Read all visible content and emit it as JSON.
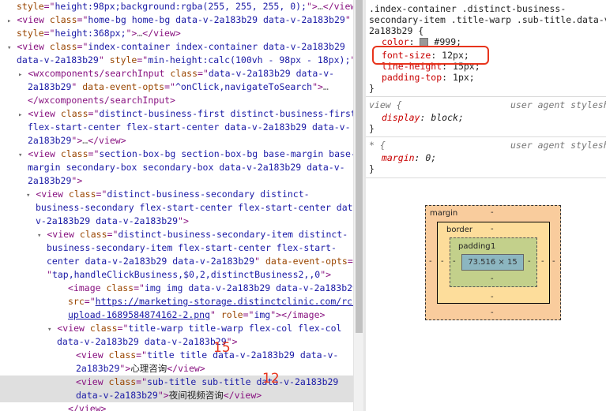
{
  "dom_lines": [
    {
      "segments": [
        {
          "c": "an",
          "t": "style"
        },
        {
          "c": "tag",
          "t": "=\""
        },
        {
          "c": "av",
          "t": "height:98px;background:rgba(255, 255, 255, 0);"
        },
        {
          "c": "tag",
          "t": "\">"
        },
        {
          "c": "gy",
          "t": "…"
        },
        {
          "c": "tag",
          "t": "</view>"
        }
      ]
    },
    {
      "segments": [
        {
          "c": "ar",
          "t": "▸"
        },
        {
          "c": "tag",
          "t": "<view "
        },
        {
          "c": "an",
          "t": "class"
        },
        {
          "c": "tag",
          "t": "=\""
        },
        {
          "c": "av",
          "t": "home-bg home-bg data-v-2a183b29 data-v-2a183b29"
        },
        {
          "c": "tag",
          "t": "\""
        }
      ]
    },
    {
      "segments": [
        {
          "c": "an",
          "t": "style"
        },
        {
          "c": "tag",
          "t": "=\""
        },
        {
          "c": "av",
          "t": "height:368px;"
        },
        {
          "c": "tag",
          "t": "\">"
        },
        {
          "c": "gy",
          "t": "…"
        },
        {
          "c": "tag",
          "t": "</view>"
        }
      ]
    },
    {
      "segments": [
        {
          "c": "ar",
          "t": "▾"
        },
        {
          "c": "tag",
          "t": "<view "
        },
        {
          "c": "an",
          "t": "class"
        },
        {
          "c": "tag",
          "t": "=\""
        },
        {
          "c": "av",
          "t": "index-container index-container data-v-2a183b29"
        }
      ]
    },
    {
      "segments": [
        {
          "c": "av",
          "t": "data-v-2a183b29"
        },
        {
          "c": "tag",
          "t": "\" "
        },
        {
          "c": "an",
          "t": "style"
        },
        {
          "c": "tag",
          "t": "=\""
        },
        {
          "c": "av",
          "t": "min-height:calc(100vh - 98px - 18px);"
        },
        {
          "c": "tag",
          "t": "\">"
        }
      ]
    },
    {
      "segments": [
        {
          "c": "ar",
          "t": "▸"
        },
        {
          "c": "tag",
          "t": "<wxcomponents/searchInput "
        },
        {
          "c": "an",
          "t": "class"
        },
        {
          "c": "tag",
          "t": "=\""
        },
        {
          "c": "av",
          "t": "data-v-2a183b29 data-v-"
        }
      ]
    },
    {
      "segments": [
        {
          "c": "av",
          "t": "2a183b29"
        },
        {
          "c": "tag",
          "t": "\" "
        },
        {
          "c": "an",
          "t": "data-event-opts"
        },
        {
          "c": "tag",
          "t": "=\""
        },
        {
          "c": "av",
          "t": "^onClick,navigateToSearch"
        },
        {
          "c": "tag",
          "t": "\">"
        },
        {
          "c": "gy",
          "t": "…"
        }
      ]
    },
    {
      "segments": [
        {
          "c": "tag",
          "t": "</wxcomponents/searchInput>"
        }
      ]
    },
    {
      "segments": [
        {
          "c": "ar",
          "t": "▸"
        },
        {
          "c": "tag",
          "t": "<view "
        },
        {
          "c": "an",
          "t": "class"
        },
        {
          "c": "tag",
          "t": "=\""
        },
        {
          "c": "av",
          "t": "distinct-business-first distinct-business-first"
        }
      ]
    },
    {
      "segments": [
        {
          "c": "av",
          "t": "flex-start-center flex-start-center data-v-2a183b29 data-v-"
        }
      ]
    },
    {
      "segments": [
        {
          "c": "av",
          "t": "2a183b29"
        },
        {
          "c": "tag",
          "t": "\">"
        },
        {
          "c": "gy",
          "t": "…"
        },
        {
          "c": "tag",
          "t": "</view>"
        }
      ]
    },
    {
      "segments": [
        {
          "c": "ar",
          "t": "▾"
        },
        {
          "c": "tag",
          "t": "<view "
        },
        {
          "c": "an",
          "t": "class"
        },
        {
          "c": "tag",
          "t": "=\""
        },
        {
          "c": "av",
          "t": "section-box-bg section-box-bg base-margin base-"
        }
      ]
    },
    {
      "segments": [
        {
          "c": "av",
          "t": "margin secondary-box secondary-box data-v-2a183b29 data-v-"
        }
      ]
    },
    {
      "segments": [
        {
          "c": "av",
          "t": "2a183b29"
        },
        {
          "c": "tag",
          "t": "\">"
        }
      ]
    },
    {
      "segments": [
        {
          "c": "ar",
          "t": "▾"
        },
        {
          "c": "tag",
          "t": "<view "
        },
        {
          "c": "an",
          "t": "class"
        },
        {
          "c": "tag",
          "t": "=\""
        },
        {
          "c": "av",
          "t": "distinct-business-secondary distinct-"
        }
      ]
    },
    {
      "segments": [
        {
          "c": "av",
          "t": "business-secondary flex-start-center flex-start-center data-"
        }
      ]
    },
    {
      "segments": [
        {
          "c": "av",
          "t": "v-2a183b29 data-v-2a183b29"
        },
        {
          "c": "tag",
          "t": "\">"
        }
      ]
    },
    {
      "segments": [
        {
          "c": "ar",
          "t": "▾"
        },
        {
          "c": "tag",
          "t": "<view "
        },
        {
          "c": "an",
          "t": "class"
        },
        {
          "c": "tag",
          "t": "=\""
        },
        {
          "c": "av",
          "t": "distinct-business-secondary-item distinct-"
        }
      ]
    },
    {
      "segments": [
        {
          "c": "av",
          "t": "business-secondary-item flex-start-center flex-start-"
        }
      ]
    },
    {
      "segments": [
        {
          "c": "av",
          "t": "center data-v-2a183b29 data-v-2a183b29"
        },
        {
          "c": "tag",
          "t": "\" "
        },
        {
          "c": "an",
          "t": "data-event-opts"
        },
        {
          "c": "tag",
          "t": "="
        }
      ]
    },
    {
      "segments": [
        {
          "c": "tag",
          "t": "\""
        },
        {
          "c": "av",
          "t": "tap,handleClickBusiness,$0,2,distinctBusiness2,,0"
        },
        {
          "c": "tag",
          "t": "\">"
        }
      ]
    },
    {
      "segments": [
        {
          "c": "tag",
          "t": "<image "
        },
        {
          "c": "an",
          "t": "class"
        },
        {
          "c": "tag",
          "t": "=\""
        },
        {
          "c": "av",
          "t": "img img data-v-2a183b29 data-v-2a183b29"
        },
        {
          "c": "tag",
          "t": "\""
        }
      ]
    },
    {
      "segments": [
        {
          "c": "an",
          "t": "src"
        },
        {
          "c": "tag",
          "t": "=\""
        },
        {
          "c": "lnk",
          "t": "https://marketing-storage.distinctclinic.com/rc-"
        }
      ]
    },
    {
      "segments": [
        {
          "c": "lnk",
          "t": "upload-1689584874162-2.png"
        },
        {
          "c": "tag",
          "t": "\" "
        },
        {
          "c": "an",
          "t": "role"
        },
        {
          "c": "tag",
          "t": "=\""
        },
        {
          "c": "av",
          "t": "img"
        },
        {
          "c": "tag",
          "t": "\"></image>"
        }
      ]
    },
    {
      "segments": [
        {
          "c": "ar",
          "t": "▾"
        },
        {
          "c": "tag",
          "t": "<view "
        },
        {
          "c": "an",
          "t": "class"
        },
        {
          "c": "tag",
          "t": "=\""
        },
        {
          "c": "av",
          "t": "title-warp title-warp flex-col flex-col"
        }
      ]
    },
    {
      "segments": [
        {
          "c": "av",
          "t": "data-v-2a183b29 data-v-2a183b29"
        },
        {
          "c": "tag",
          "t": "\">"
        }
      ]
    },
    {
      "segments": [
        {
          "c": "tag",
          "t": "<view "
        },
        {
          "c": "an",
          "t": "class"
        },
        {
          "c": "tag",
          "t": "=\""
        },
        {
          "c": "av",
          "t": "title title data-v-2a183b29 data-v-"
        }
      ]
    },
    {
      "segments": [
        {
          "c": "av",
          "t": "2a183b29"
        },
        {
          "c": "tag",
          "t": "\">"
        },
        {
          "c": "txt",
          "t": "心理咨询"
        },
        {
          "c": "tag",
          "t": "</view>"
        }
      ]
    },
    {
      "segments": [
        {
          "c": "tag",
          "t": "<view "
        },
        {
          "c": "an",
          "t": "class"
        },
        {
          "c": "tag",
          "t": "=\""
        },
        {
          "c": "av",
          "t": "sub-title sub-title data-v-2a183b29"
        }
      ]
    },
    {
      "segments": [
        {
          "c": "av",
          "t": "data-v-2a183b29"
        },
        {
          "c": "tag",
          "t": "\">"
        },
        {
          "c": "txt",
          "t": "夜间视频咨询"
        },
        {
          "c": "tag",
          "t": "</view>"
        }
      ]
    },
    {
      "segments": [
        {
          "c": "tag",
          "t": "</view>"
        }
      ]
    },
    {
      "segments": [
        {
          "c": "tag",
          "t": "</view>"
        }
      ]
    }
  ],
  "annotations": {
    "title_size": "15",
    "subtitle_size": "12"
  },
  "styles": {
    "selector_lines": [
      ".index-container .distinct-business-",
      "secondary-item .title-warp .sub-title.data-v-",
      "2a183b29 {"
    ],
    "rules": [
      {
        "prop": "color",
        "val": "#999;"
      },
      {
        "prop": "font-size",
        "val": "12px;"
      },
      {
        "prop": "line-height",
        "val": "15px;"
      },
      {
        "prop": "padding-top",
        "val": "1px;"
      }
    ],
    "close_brace": "}",
    "ua_rule1": {
      "selector": "view {",
      "source": "user agent styleshe",
      "prop": "display",
      "val": "block;"
    },
    "ua_rule2": {
      "selector": "* {",
      "source": "user agent styleshe",
      "prop": "margin",
      "val": "0;"
    }
  },
  "box_model": {
    "margin_label": "margin",
    "border_label": "border",
    "padding_label": "padding",
    "padding_top": "1",
    "content": "73.516 × 15",
    "dash": "-"
  }
}
